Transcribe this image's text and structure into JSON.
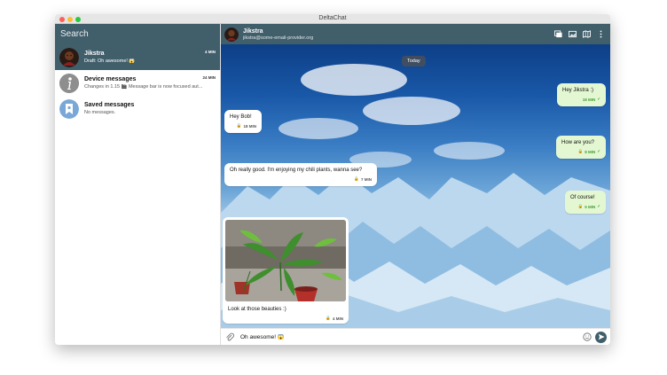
{
  "window": {
    "title": "DeltaChat"
  },
  "sidebar": {
    "search_placeholder": "Search",
    "chats": [
      {
        "name": "Jikstra",
        "snippet": "Draft: Oh awesome! 😱",
        "time": "4 MIN",
        "active": true
      },
      {
        "name": "Device messages",
        "snippet": "Changes in 1.15 🎬 Message bar is now focused aut...",
        "time": "24 MIN",
        "active": false
      },
      {
        "name": "Saved messages",
        "snippet": "No messages.",
        "time": "",
        "active": false
      }
    ]
  },
  "header": {
    "name": "Jikstra",
    "address": "jikstra@some-email-provider.org"
  },
  "conversation": {
    "day_label": "Today",
    "messages": [
      {
        "direction": "out",
        "text": "Hey Jikstra :)",
        "time": "18 MIN"
      },
      {
        "direction": "in",
        "text": "Hey Bob!",
        "time": "18 MIN"
      },
      {
        "direction": "out",
        "text": "How are you?",
        "time": "8 MIN"
      },
      {
        "direction": "in",
        "text": "Oh really good. I'm enjoying my chili plants, wanna see?",
        "time": "7 MIN"
      },
      {
        "direction": "out",
        "text": "Of course!",
        "time": "5 MIN"
      },
      {
        "direction": "in",
        "text": "Look at those beauties :)",
        "time": "4 MIN"
      }
    ]
  },
  "composer": {
    "draft_text": "Oh awesome! 😱"
  },
  "colors": {
    "accent": "#415e6b",
    "outgoing_bubble": "#e4f7d3",
    "outgoing_meta": "#4a9a3a",
    "incoming_bubble": "#ffffff"
  }
}
